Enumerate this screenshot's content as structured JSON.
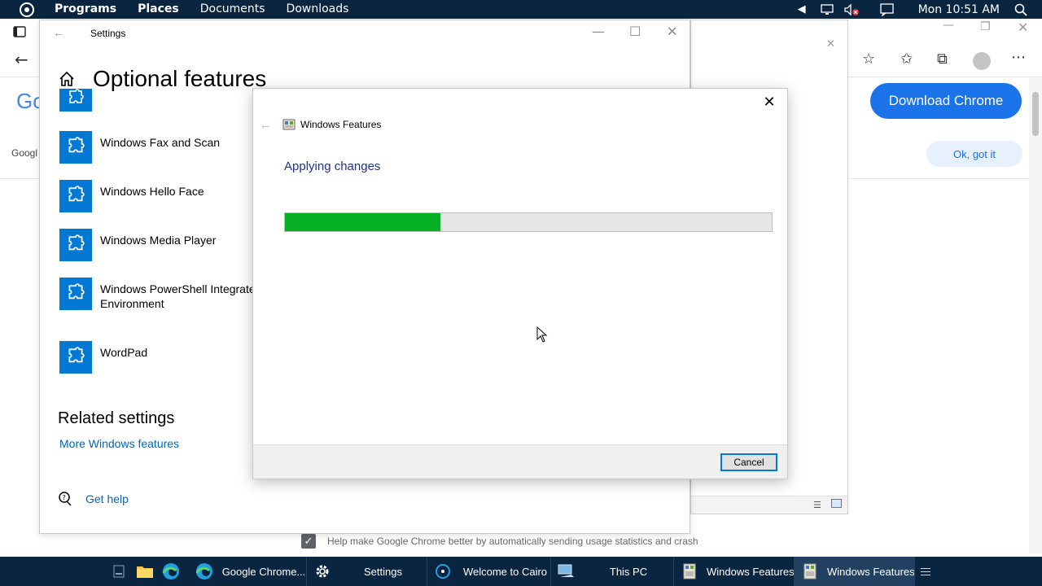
{
  "topbar": {
    "menu": [
      "Programs",
      "Places",
      "Documents",
      "Downloads"
    ],
    "clock": "Mon 10:51 AM"
  },
  "browser": {
    "google_partial": "Go",
    "google_small": "Googl",
    "download_chrome": "Download Chrome",
    "ok_got_it": "Ok, got it",
    "usage_text": "Help make Google Chrome better by automatically sending usage statistics and crash"
  },
  "settings": {
    "window_title": "Settings",
    "page_title": "Optional features",
    "features": [
      "Windows Fax and Scan",
      "Windows Hello Face",
      "Windows Media Player",
      "Windows PowerShell Integrated Scripting Environment",
      "WordPad"
    ],
    "powershell_line1": "Windows PowerShell Integrate",
    "powershell_line2": "Environment",
    "related_title": "Related settings",
    "more_features_link": "More Windows features",
    "get_help": "Get help"
  },
  "dialog": {
    "title": "Windows Features",
    "heading": "Applying changes",
    "progress_fraction": 0.32,
    "cancel_label": "Cancel"
  },
  "taskbar": {
    "tasks": [
      {
        "label": "Google Chrome...",
        "icon": "chrome-icon"
      },
      {
        "label": "Settings",
        "icon": "gear-icon"
      },
      {
        "label": "Welcome to Cairo",
        "icon": "cairo-icon"
      },
      {
        "label": "This PC",
        "icon": "computer-icon"
      },
      {
        "label": "Windows Features",
        "icon": "windows-features-icon"
      },
      {
        "label": "Windows Features",
        "icon": "windows-features-icon"
      }
    ],
    "active_index": 5
  },
  "colors": {
    "accent": "#0078d4",
    "progress_green": "#06b025",
    "panel_dark": "#0a2540",
    "chrome_blue": "#1a73e8"
  }
}
